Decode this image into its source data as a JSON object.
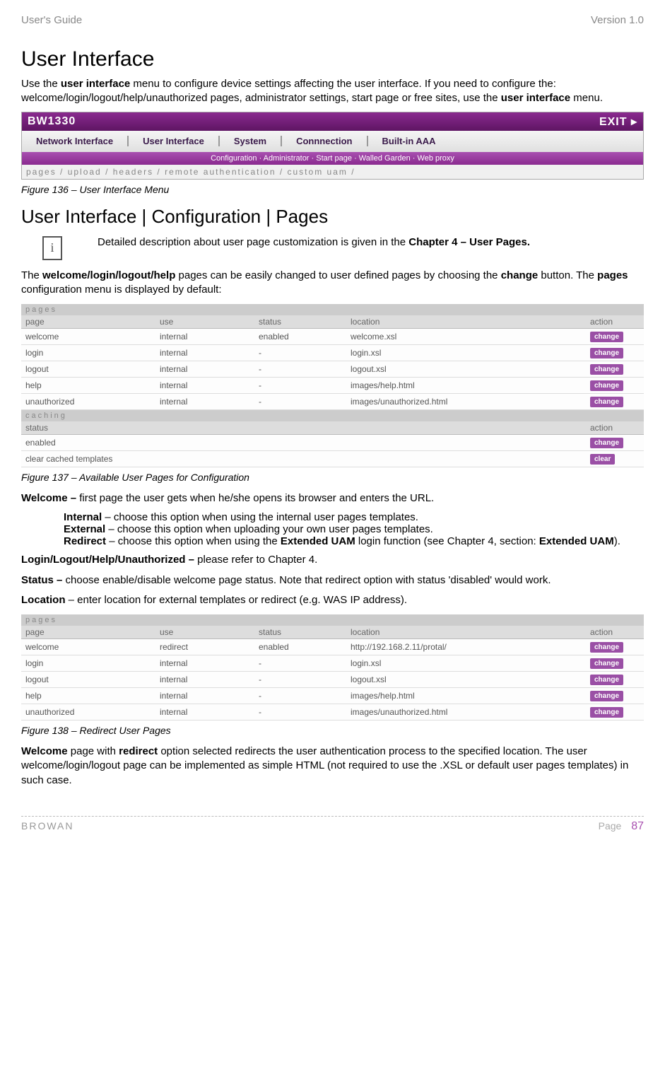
{
  "header": {
    "left": "User's Guide",
    "right": "Version 1.0"
  },
  "h1": "User Interface",
  "intro": "Use the user interface menu to configure device settings affecting the user interface. If you need to configure the: welcome/login/logout/help/unauthorized pages, administrator settings, start page or free sites, use the user interface menu.",
  "intro_parts": {
    "p1": "Use the ",
    "b1": "user interface",
    "p2": " menu to configure device settings affecting the user interface. If you need to configure the: welcome/login/logout/help/unauthorized pages, administrator settings, start page or free sites, use the ",
    "b2": "user interface",
    "p3": " menu."
  },
  "nav": {
    "brand": "BW1330",
    "exit": "EXIT ▸",
    "tabs": [
      "Network Interface",
      "User Interface",
      "System",
      "Connnection",
      "Built-in AAA"
    ],
    "sub": "Configuration  ·  Administrator  ·  Start page  ·  Walled Garden  ·  Web proxy",
    "breadcrumb": "pages / upload / headers / remote authentication / custom uam /"
  },
  "fig136": "Figure 136 – User Interface Menu",
  "h2": "User Interface | Configuration | Pages",
  "info": {
    "p1": "Detailed description about user page customization is given in the ",
    "b1": "Chapter 4 – User Pages."
  },
  "para2": {
    "p1": "The ",
    "b1": "welcome/login/logout/help",
    "p2": " pages can be easily changed to user defined pages by choosing the ",
    "b2": "change",
    "p3": " button. The ",
    "b3": "pages",
    "p4": " configuration menu is displayed by default:"
  },
  "table1": {
    "title": "pages",
    "head": {
      "c1": "page",
      "c2": "use",
      "c3": "status",
      "c4": "location",
      "c5": "action"
    },
    "rows": [
      {
        "page": "welcome",
        "use": "internal",
        "status": "enabled",
        "location": "welcome.xsl",
        "action": "change"
      },
      {
        "page": "login",
        "use": "internal",
        "status": "-",
        "location": "login.xsl",
        "action": "change"
      },
      {
        "page": "logout",
        "use": "internal",
        "status": "-",
        "location": "logout.xsl",
        "action": "change"
      },
      {
        "page": "help",
        "use": "internal",
        "status": "-",
        "location": "images/help.html",
        "action": "change"
      },
      {
        "page": "unauthorized",
        "use": "internal",
        "status": "-",
        "location": "images/unauthorized.html",
        "action": "change"
      }
    ],
    "caching_title": "caching",
    "caching_head": {
      "c1": "status",
      "c5": "action"
    },
    "caching_rows": [
      {
        "status": "enabled",
        "action": "change"
      },
      {
        "status": "clear cached templates",
        "action": "clear"
      }
    ]
  },
  "fig137": "Figure 137 – Available User Pages for Configuration",
  "welcome_line": {
    "b1": "Welcome – ",
    "p1": "first page the user gets when he/she opens its browser and enters the URL."
  },
  "options": {
    "internal_b": "Internal",
    "internal_t": " – choose this option when using the internal user pages templates.",
    "external_b": "External",
    "external_t": " – choose this option when uploading your own user pages templates.",
    "redirect_b": "Redirect",
    "redirect_t1": " – choose this option when using the ",
    "redirect_b2": "Extended UAM",
    "redirect_t2": " login function (see Chapter 4, section: ",
    "redirect_b3": "Extended UAM",
    "redirect_t3": ")."
  },
  "llhu": {
    "b1": "Login/Logout/Help/Unauthorized – ",
    "p1": "please refer to Chapter 4."
  },
  "status_line": {
    "b1": "Status – ",
    "p1": "choose enable/disable welcome page status. Note that redirect option with status 'disabled' would work."
  },
  "location_line": {
    "b1": "Location",
    "p1": " – enter location for external templates or redirect (e.g. WAS IP address)."
  },
  "table2": {
    "title": "pages",
    "head": {
      "c1": "page",
      "c2": "use",
      "c3": "status",
      "c4": "location",
      "c5": "action"
    },
    "rows": [
      {
        "page": "welcome",
        "use": "redirect",
        "status": "enabled",
        "location": "http://192.168.2.11/protal/",
        "action": "change"
      },
      {
        "page": "login",
        "use": "internal",
        "status": "-",
        "location": "login.xsl",
        "action": "change"
      },
      {
        "page": "logout",
        "use": "internal",
        "status": "-",
        "location": "logout.xsl",
        "action": "change"
      },
      {
        "page": "help",
        "use": "internal",
        "status": "-",
        "location": "images/help.html",
        "action": "change"
      },
      {
        "page": "unauthorized",
        "use": "internal",
        "status": "-",
        "location": "images/unauthorized.html",
        "action": "change"
      }
    ]
  },
  "fig138": "Figure 138 – Redirect User Pages",
  "final": {
    "b1": "Welcome",
    "p1": " page with ",
    "b2": "redirect",
    "p2": " option selected redirects the user authentication process to the specified location. The user welcome/login/logout page can be implemented as simple HTML (not required to use the .XSL or default user pages templates) in such case."
  },
  "footer": {
    "left": "BROWAN",
    "right_label": "Page",
    "right_num": "87"
  }
}
